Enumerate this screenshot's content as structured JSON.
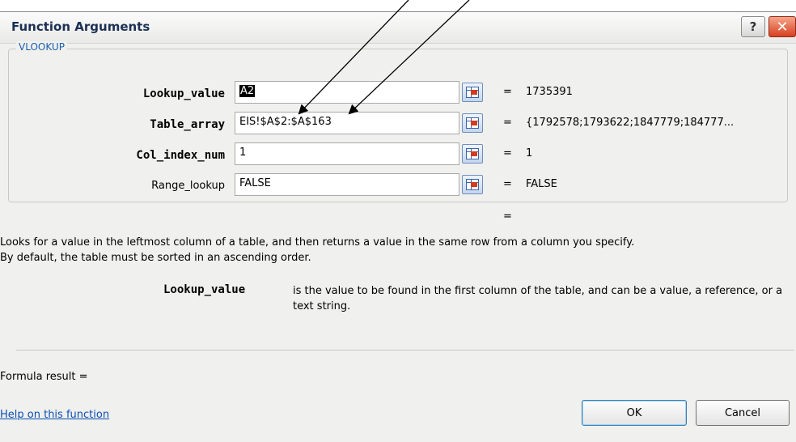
{
  "dialog": {
    "title": "Function Arguments",
    "help_glyph": "?",
    "close_glyph": "✕",
    "group_label": "VLOOKUP"
  },
  "arguments": [
    {
      "label": "Lookup_value",
      "value_selected": "A2",
      "value": "",
      "result": "1735391",
      "bold": true
    },
    {
      "label": "Table_array",
      "value_selected": "",
      "value": "EIS!$A$2:$A$163",
      "result": "{1792578;1793622;1847779;184777...",
      "bold": true
    },
    {
      "label": "Col_index_num",
      "value_selected": "",
      "value": "1",
      "result": "1",
      "bold": true
    },
    {
      "label": "Range_lookup",
      "value_selected": "",
      "value": "FALSE",
      "result": "FALSE",
      "bold": false
    }
  ],
  "equals_sign": "=",
  "function_result_equals": "=",
  "description": {
    "line1": "Looks for a value in the leftmost column of a table, and then returns a value in the same row from a column you specify.",
    "line2": "By default, the table must be sorted in an ascending order."
  },
  "arg_help": {
    "name": "Lookup_value",
    "text": "is the value to be found in the first column of the table, and can be a value, a reference, or a text string."
  },
  "formula_result_label": "Formula result =",
  "help_link": "Help on this function",
  "buttons": {
    "ok": "OK",
    "cancel": "Cancel"
  },
  "annotation_arrows": {
    "count": 2,
    "color": "#000000",
    "points_to": "Table_array"
  }
}
